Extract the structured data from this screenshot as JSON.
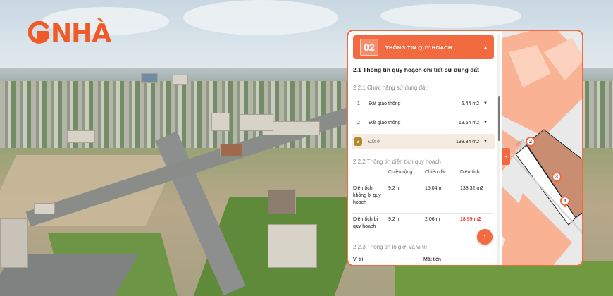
{
  "brand": {
    "logo_text": "NHÀ",
    "logo_letter": "G",
    "accent": "#f26a3f"
  },
  "panel": {
    "section_number": "02",
    "section_title": "THÔNG TIN QUY HOẠCH",
    "heading": "2.1 Thông tin quy hoạch chi tiết sử dụng đất",
    "land_use": {
      "title": "2.2.1 Chức năng sử dụng đất",
      "items": [
        {
          "index": "1",
          "name": "Đất giao thông",
          "value": "5.44 m2"
        },
        {
          "index": "2",
          "name": "Đất giao thông",
          "value": "13.54 m2"
        },
        {
          "index": "3",
          "name": "Đất ở",
          "value": "138.34 m2"
        }
      ]
    },
    "area_info": {
      "title": "2.2.2 Thông tin diện tích quy hoạch",
      "columns": [
        "Chiều rộng",
        "Chiều dài",
        "Diện tích"
      ],
      "rows": [
        {
          "label": "Diện tích không bị quy hoạch",
          "width": "9.2 m",
          "length": "15.04 m",
          "area": "138.32 m2"
        },
        {
          "label": "Diện tích bị quy hoạch",
          "width": "9.2 m",
          "length": "2.06 m",
          "area": "18.99 m2"
        }
      ]
    },
    "boundary": {
      "title": "2.2.3 Thông tin lộ giới và vị trí",
      "col_position": "Vị trí",
      "col_frontage": "Mặt tiền"
    },
    "fab_icon": "arrow-up-icon"
  },
  "map": {
    "street_label": "ừng",
    "pins": [
      "1",
      "2",
      "3"
    ]
  }
}
